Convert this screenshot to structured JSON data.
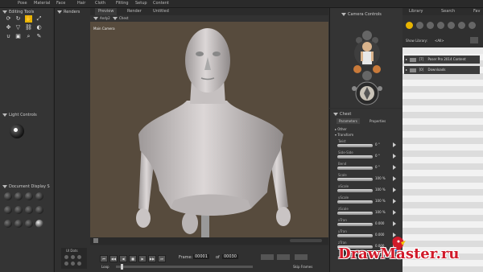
{
  "menu": {
    "items": [
      "Pose",
      "Material",
      "Face",
      "Hair",
      "Cloth",
      "Fitting",
      "Setup",
      "Content"
    ]
  },
  "left": {
    "editing_tools": "Editing Tools",
    "light_controls": "Light Controls",
    "document_display": "Document Display S",
    "ui_dots": "UI Dots"
  },
  "renders": {
    "label": "Renders"
  },
  "viewport": {
    "tabs": [
      "Preview",
      "Render",
      "Untitled"
    ],
    "figure_select": "Andy2",
    "part_select": "Chest",
    "camera_label": "Main Camera"
  },
  "camera": {
    "title": "Camera Controls"
  },
  "properties": {
    "title": "Chest",
    "tabs": [
      "Parameters",
      "Properties"
    ],
    "groups": [
      "Other",
      "Transform"
    ],
    "params": [
      {
        "name": "Twist",
        "value": "0 °"
      },
      {
        "name": "Side-Side",
        "value": "0 °"
      },
      {
        "name": "Bend",
        "value": "0 °"
      },
      {
        "name": "Scale",
        "value": "100 %"
      },
      {
        "name": "xScale",
        "value": "100 %"
      },
      {
        "name": "yScale",
        "value": "100 %"
      },
      {
        "name": "zScale",
        "value": "100 %"
      },
      {
        "name": "xTran",
        "value": "0.000"
      },
      {
        "name": "yTran",
        "value": "0.000"
      },
      {
        "name": "zTran",
        "value": "0.000"
      }
    ]
  },
  "library": {
    "tabs": [
      "Library",
      "Search",
      "Fav"
    ],
    "show_library": "Show Library:",
    "show_value": "<All>",
    "items": [
      {
        "count": "[7]",
        "name": "Poser Pro 2014 Content"
      },
      {
        "count": "[0]",
        "name": "Downloads"
      }
    ]
  },
  "timeline": {
    "frame_label": "Frame:",
    "frame_value": "00001",
    "of_label": "of",
    "total_value": "00030",
    "loop_label": "Loop",
    "skip_label": "Skip Frames"
  },
  "watermark": {
    "text": "DrawMaster.ru"
  },
  "colors": {
    "viewport_bg": "#574b3d",
    "figure": "#cdc8c8",
    "selection": "#e8b400",
    "watermark_red": "#d11a2a"
  }
}
